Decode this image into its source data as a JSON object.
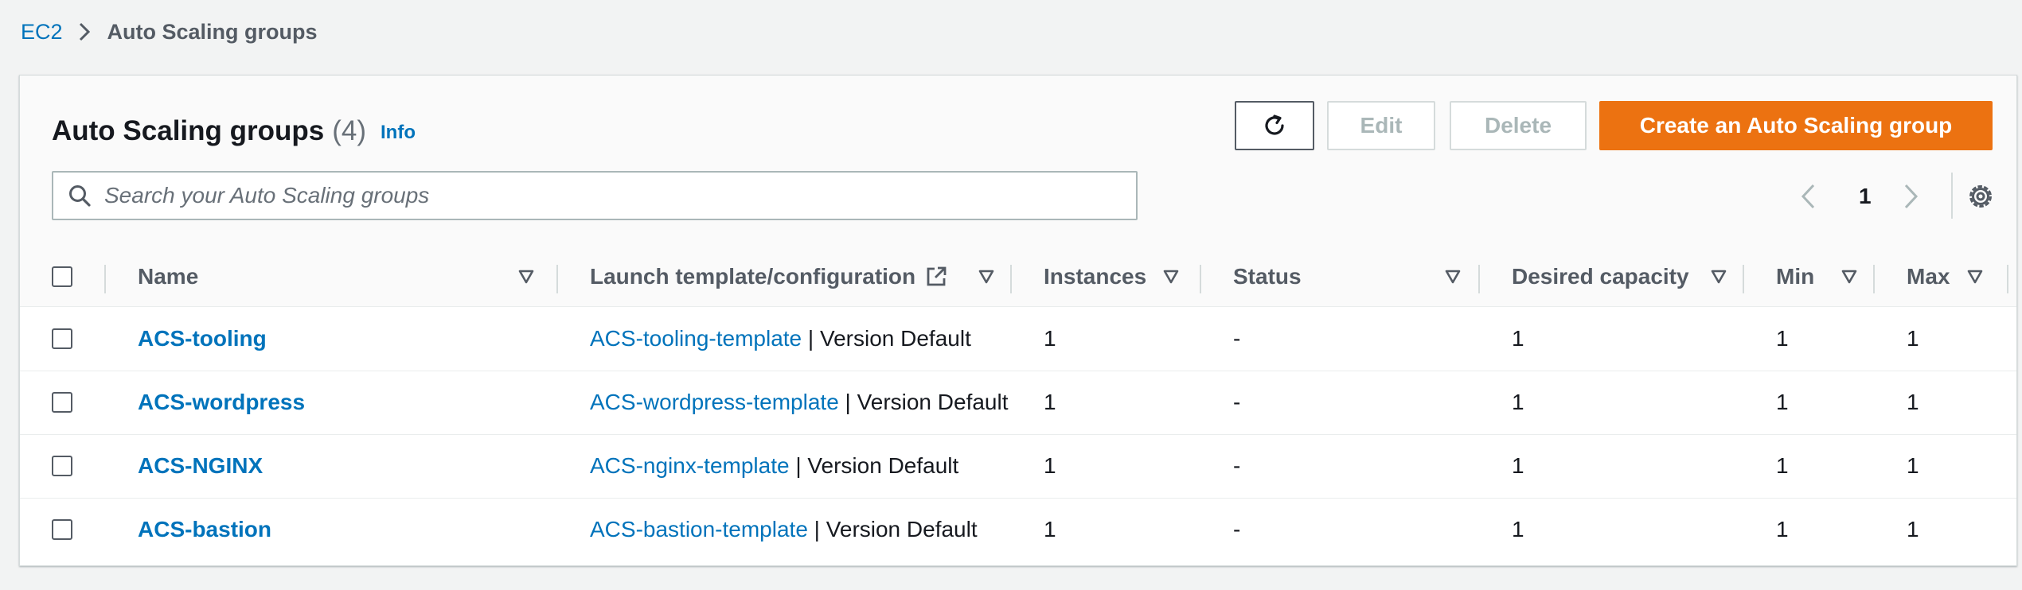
{
  "breadcrumb": {
    "root": "EC2",
    "current": "Auto Scaling groups"
  },
  "header": {
    "title": "Auto Scaling groups",
    "count": "(4)",
    "info": "Info"
  },
  "actions": {
    "refresh_icon": "refresh-icon",
    "edit": "Edit",
    "delete": "Delete",
    "create": "Create an Auto Scaling group"
  },
  "search": {
    "placeholder": "Search your Auto Scaling groups",
    "value": ""
  },
  "pagination": {
    "current_page": "1"
  },
  "table": {
    "columns": [
      "Name",
      "Launch template/configuration",
      "Instances",
      "Status",
      "Desired capacity",
      "Min",
      "Max"
    ],
    "rows": [
      {
        "name": "ACS-tooling",
        "template": "ACS-tooling-template",
        "template_suffix": " | Version Default",
        "instances": "1",
        "status": "-",
        "desired": "1",
        "min": "1",
        "max": "1"
      },
      {
        "name": "ACS-wordpress",
        "template": "ACS-wordpress-template",
        "template_suffix": " | Version Default",
        "instances": "1",
        "status": "-",
        "desired": "1",
        "min": "1",
        "max": "1"
      },
      {
        "name": "ACS-NGINX",
        "template": "ACS-nginx-template",
        "template_suffix": " | Version Default",
        "instances": "1",
        "status": "-",
        "desired": "1",
        "min": "1",
        "max": "1"
      },
      {
        "name": "ACS-bastion",
        "template": "ACS-bastion-template",
        "template_suffix": " | Version Default",
        "instances": "1",
        "status": "-",
        "desired": "1",
        "min": "1",
        "max": "1"
      }
    ]
  },
  "colors": {
    "link": "#0073bb",
    "primary_button": "#ec7211",
    "text": "#16191f",
    "muted": "#545b64",
    "background": "#f2f3f3"
  }
}
